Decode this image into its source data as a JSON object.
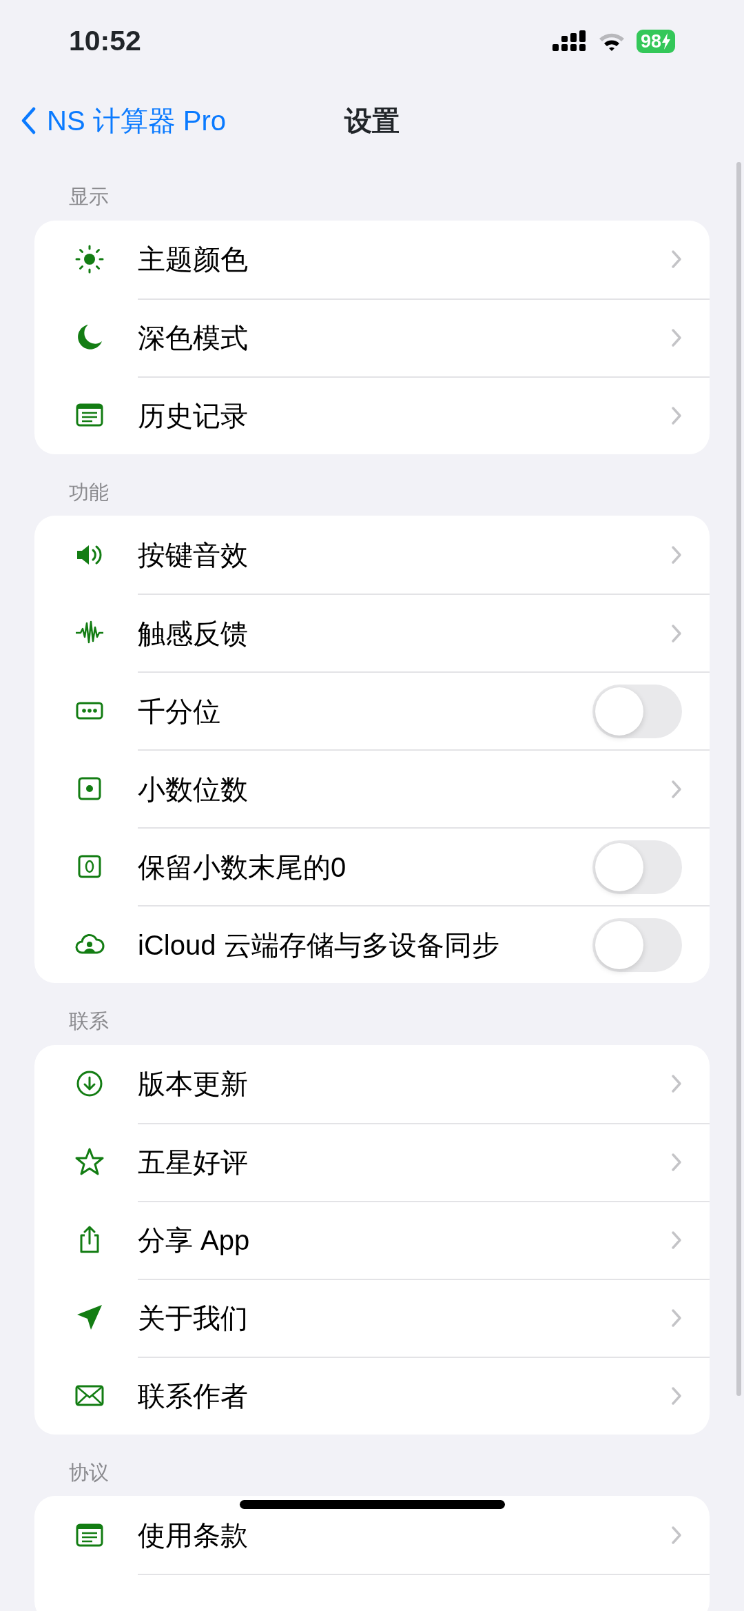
{
  "status_bar": {
    "time": "10:52",
    "battery": "98"
  },
  "nav": {
    "back": "NS 计算器 Pro",
    "title": "设置"
  },
  "sections": [
    {
      "header": "显示",
      "rows": [
        {
          "kind": "link",
          "label": "主题颜色"
        },
        {
          "kind": "link",
          "label": "深色模式"
        },
        {
          "kind": "link",
          "label": "历史记录"
        }
      ]
    },
    {
      "header": "功能",
      "rows": [
        {
          "kind": "link",
          "label": "按键音效"
        },
        {
          "kind": "link",
          "label": "触感反馈"
        },
        {
          "kind": "toggle",
          "label": "千分位",
          "on": false
        },
        {
          "kind": "link",
          "label": "小数位数"
        },
        {
          "kind": "toggle",
          "label": "保留小数末尾的0",
          "on": false
        },
        {
          "kind": "toggle",
          "label": "iCloud 云端存储与多设备同步",
          "on": false
        }
      ]
    },
    {
      "header": "联系",
      "rows": [
        {
          "kind": "link",
          "label": "版本更新"
        },
        {
          "kind": "link",
          "label": "五星好评"
        },
        {
          "kind": "link",
          "label": "分享 App"
        },
        {
          "kind": "link",
          "label": "关于我们"
        },
        {
          "kind": "link",
          "label": "联系作者"
        }
      ]
    },
    {
      "header": "协议",
      "rows": [
        {
          "kind": "link",
          "label": "使用条款"
        }
      ]
    }
  ]
}
